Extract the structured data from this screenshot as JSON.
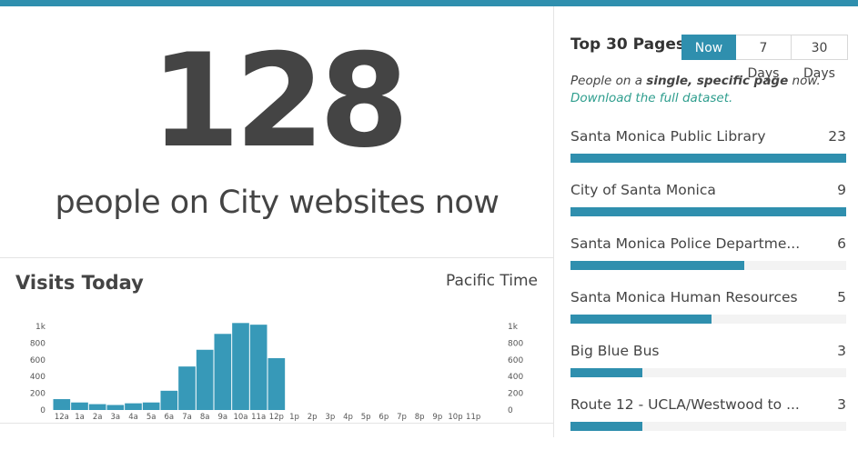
{
  "now": {
    "count": "128",
    "caption": "people on City websites now"
  },
  "visits": {
    "title": "Visits Today",
    "timezone": "Pacific Time"
  },
  "chart_data": {
    "type": "bar",
    "title": "Visits Today",
    "categories": [
      "12a",
      "1a",
      "2a",
      "3a",
      "4a",
      "5a",
      "6a",
      "7a",
      "8a",
      "9a",
      "10a",
      "11a",
      "12p",
      "1p",
      "2p",
      "3p",
      "4p",
      "5p",
      "6p",
      "7p",
      "8p",
      "9p",
      "10p",
      "11p"
    ],
    "values": [
      130,
      90,
      70,
      60,
      80,
      90,
      230,
      520,
      720,
      910,
      1040,
      1020,
      620,
      0,
      0,
      0,
      0,
      0,
      0,
      0,
      0,
      0,
      0,
      0
    ],
    "yticks": [
      "0",
      "200",
      "400",
      "600",
      "800",
      "1k"
    ],
    "ylim": [
      0,
      1000
    ],
    "color": "#3799b8",
    "grid": false
  },
  "top_pages": {
    "title": "Top 30 Pages",
    "tabs": [
      {
        "label": "Now",
        "active": true
      },
      {
        "label": "7 Days",
        "active": false
      },
      {
        "label": "30 Days",
        "active": false
      }
    ],
    "note_pre": "People on a ",
    "note_bold": "single, specific page",
    "note_post": " now.",
    "download_link": "Download the full dataset.",
    "accent": "#2f8fae",
    "items": [
      {
        "name": "Santa Monica Public Library",
        "count": "23",
        "share": 1.0
      },
      {
        "name": "City of Santa Monica",
        "count": "9",
        "share": 1.0
      },
      {
        "name": "Santa Monica Police Departme...",
        "count": "6",
        "share": 0.63
      },
      {
        "name": "Santa Monica Human Resources",
        "count": "5",
        "share": 0.51
      },
      {
        "name": "Big Blue Bus",
        "count": "3",
        "share": 0.26
      },
      {
        "name": "Route 12 - UCLA/Westwood to ...",
        "count": "3",
        "share": 0.26
      }
    ]
  }
}
